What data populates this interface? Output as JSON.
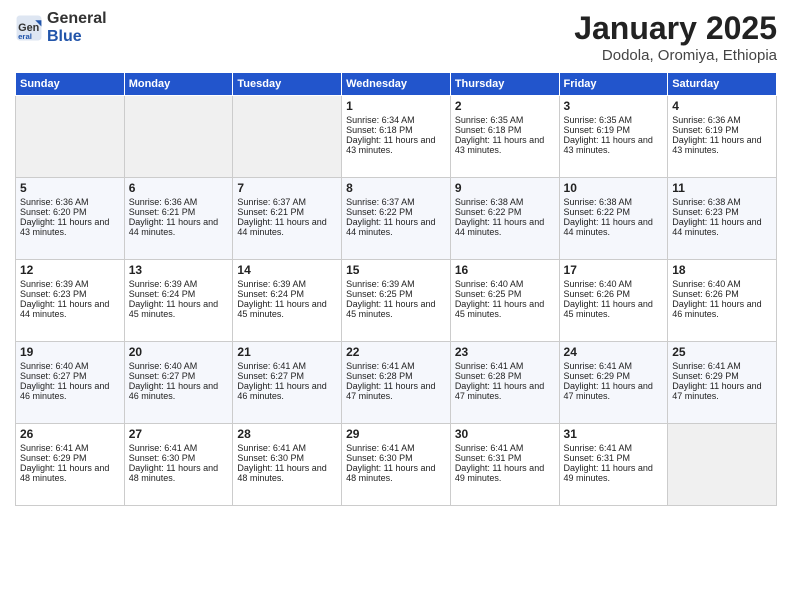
{
  "header": {
    "logo_general": "General",
    "logo_blue": "Blue",
    "month_title": "January 2025",
    "location": "Dodola, Oromiya, Ethiopia"
  },
  "weekdays": [
    "Sunday",
    "Monday",
    "Tuesday",
    "Wednesday",
    "Thursday",
    "Friday",
    "Saturday"
  ],
  "weeks": [
    [
      {
        "day": "",
        "empty": true
      },
      {
        "day": "",
        "empty": true
      },
      {
        "day": "",
        "empty": true
      },
      {
        "day": "1",
        "sunrise": "6:34 AM",
        "sunset": "6:18 PM",
        "daylight": "11 hours and 43 minutes."
      },
      {
        "day": "2",
        "sunrise": "6:35 AM",
        "sunset": "6:18 PM",
        "daylight": "11 hours and 43 minutes."
      },
      {
        "day": "3",
        "sunrise": "6:35 AM",
        "sunset": "6:19 PM",
        "daylight": "11 hours and 43 minutes."
      },
      {
        "day": "4",
        "sunrise": "6:36 AM",
        "sunset": "6:19 PM",
        "daylight": "11 hours and 43 minutes."
      }
    ],
    [
      {
        "day": "5",
        "sunrise": "6:36 AM",
        "sunset": "6:20 PM",
        "daylight": "11 hours and 43 minutes."
      },
      {
        "day": "6",
        "sunrise": "6:36 AM",
        "sunset": "6:21 PM",
        "daylight": "11 hours and 44 minutes."
      },
      {
        "day": "7",
        "sunrise": "6:37 AM",
        "sunset": "6:21 PM",
        "daylight": "11 hours and 44 minutes."
      },
      {
        "day": "8",
        "sunrise": "6:37 AM",
        "sunset": "6:22 PM",
        "daylight": "11 hours and 44 minutes."
      },
      {
        "day": "9",
        "sunrise": "6:38 AM",
        "sunset": "6:22 PM",
        "daylight": "11 hours and 44 minutes."
      },
      {
        "day": "10",
        "sunrise": "6:38 AM",
        "sunset": "6:22 PM",
        "daylight": "11 hours and 44 minutes."
      },
      {
        "day": "11",
        "sunrise": "6:38 AM",
        "sunset": "6:23 PM",
        "daylight": "11 hours and 44 minutes."
      }
    ],
    [
      {
        "day": "12",
        "sunrise": "6:39 AM",
        "sunset": "6:23 PM",
        "daylight": "11 hours and 44 minutes."
      },
      {
        "day": "13",
        "sunrise": "6:39 AM",
        "sunset": "6:24 PM",
        "daylight": "11 hours and 45 minutes."
      },
      {
        "day": "14",
        "sunrise": "6:39 AM",
        "sunset": "6:24 PM",
        "daylight": "11 hours and 45 minutes."
      },
      {
        "day": "15",
        "sunrise": "6:39 AM",
        "sunset": "6:25 PM",
        "daylight": "11 hours and 45 minutes."
      },
      {
        "day": "16",
        "sunrise": "6:40 AM",
        "sunset": "6:25 PM",
        "daylight": "11 hours and 45 minutes."
      },
      {
        "day": "17",
        "sunrise": "6:40 AM",
        "sunset": "6:26 PM",
        "daylight": "11 hours and 45 minutes."
      },
      {
        "day": "18",
        "sunrise": "6:40 AM",
        "sunset": "6:26 PM",
        "daylight": "11 hours and 46 minutes."
      }
    ],
    [
      {
        "day": "19",
        "sunrise": "6:40 AM",
        "sunset": "6:27 PM",
        "daylight": "11 hours and 46 minutes."
      },
      {
        "day": "20",
        "sunrise": "6:40 AM",
        "sunset": "6:27 PM",
        "daylight": "11 hours and 46 minutes."
      },
      {
        "day": "21",
        "sunrise": "6:41 AM",
        "sunset": "6:27 PM",
        "daylight": "11 hours and 46 minutes."
      },
      {
        "day": "22",
        "sunrise": "6:41 AM",
        "sunset": "6:28 PM",
        "daylight": "11 hours and 47 minutes."
      },
      {
        "day": "23",
        "sunrise": "6:41 AM",
        "sunset": "6:28 PM",
        "daylight": "11 hours and 47 minutes."
      },
      {
        "day": "24",
        "sunrise": "6:41 AM",
        "sunset": "6:29 PM",
        "daylight": "11 hours and 47 minutes."
      },
      {
        "day": "25",
        "sunrise": "6:41 AM",
        "sunset": "6:29 PM",
        "daylight": "11 hours and 47 minutes."
      }
    ],
    [
      {
        "day": "26",
        "sunrise": "6:41 AM",
        "sunset": "6:29 PM",
        "daylight": "11 hours and 48 minutes."
      },
      {
        "day": "27",
        "sunrise": "6:41 AM",
        "sunset": "6:30 PM",
        "daylight": "11 hours and 48 minutes."
      },
      {
        "day": "28",
        "sunrise": "6:41 AM",
        "sunset": "6:30 PM",
        "daylight": "11 hours and 48 minutes."
      },
      {
        "day": "29",
        "sunrise": "6:41 AM",
        "sunset": "6:30 PM",
        "daylight": "11 hours and 48 minutes."
      },
      {
        "day": "30",
        "sunrise": "6:41 AM",
        "sunset": "6:31 PM",
        "daylight": "11 hours and 49 minutes."
      },
      {
        "day": "31",
        "sunrise": "6:41 AM",
        "sunset": "6:31 PM",
        "daylight": "11 hours and 49 minutes."
      },
      {
        "day": "",
        "empty": true
      }
    ]
  ]
}
